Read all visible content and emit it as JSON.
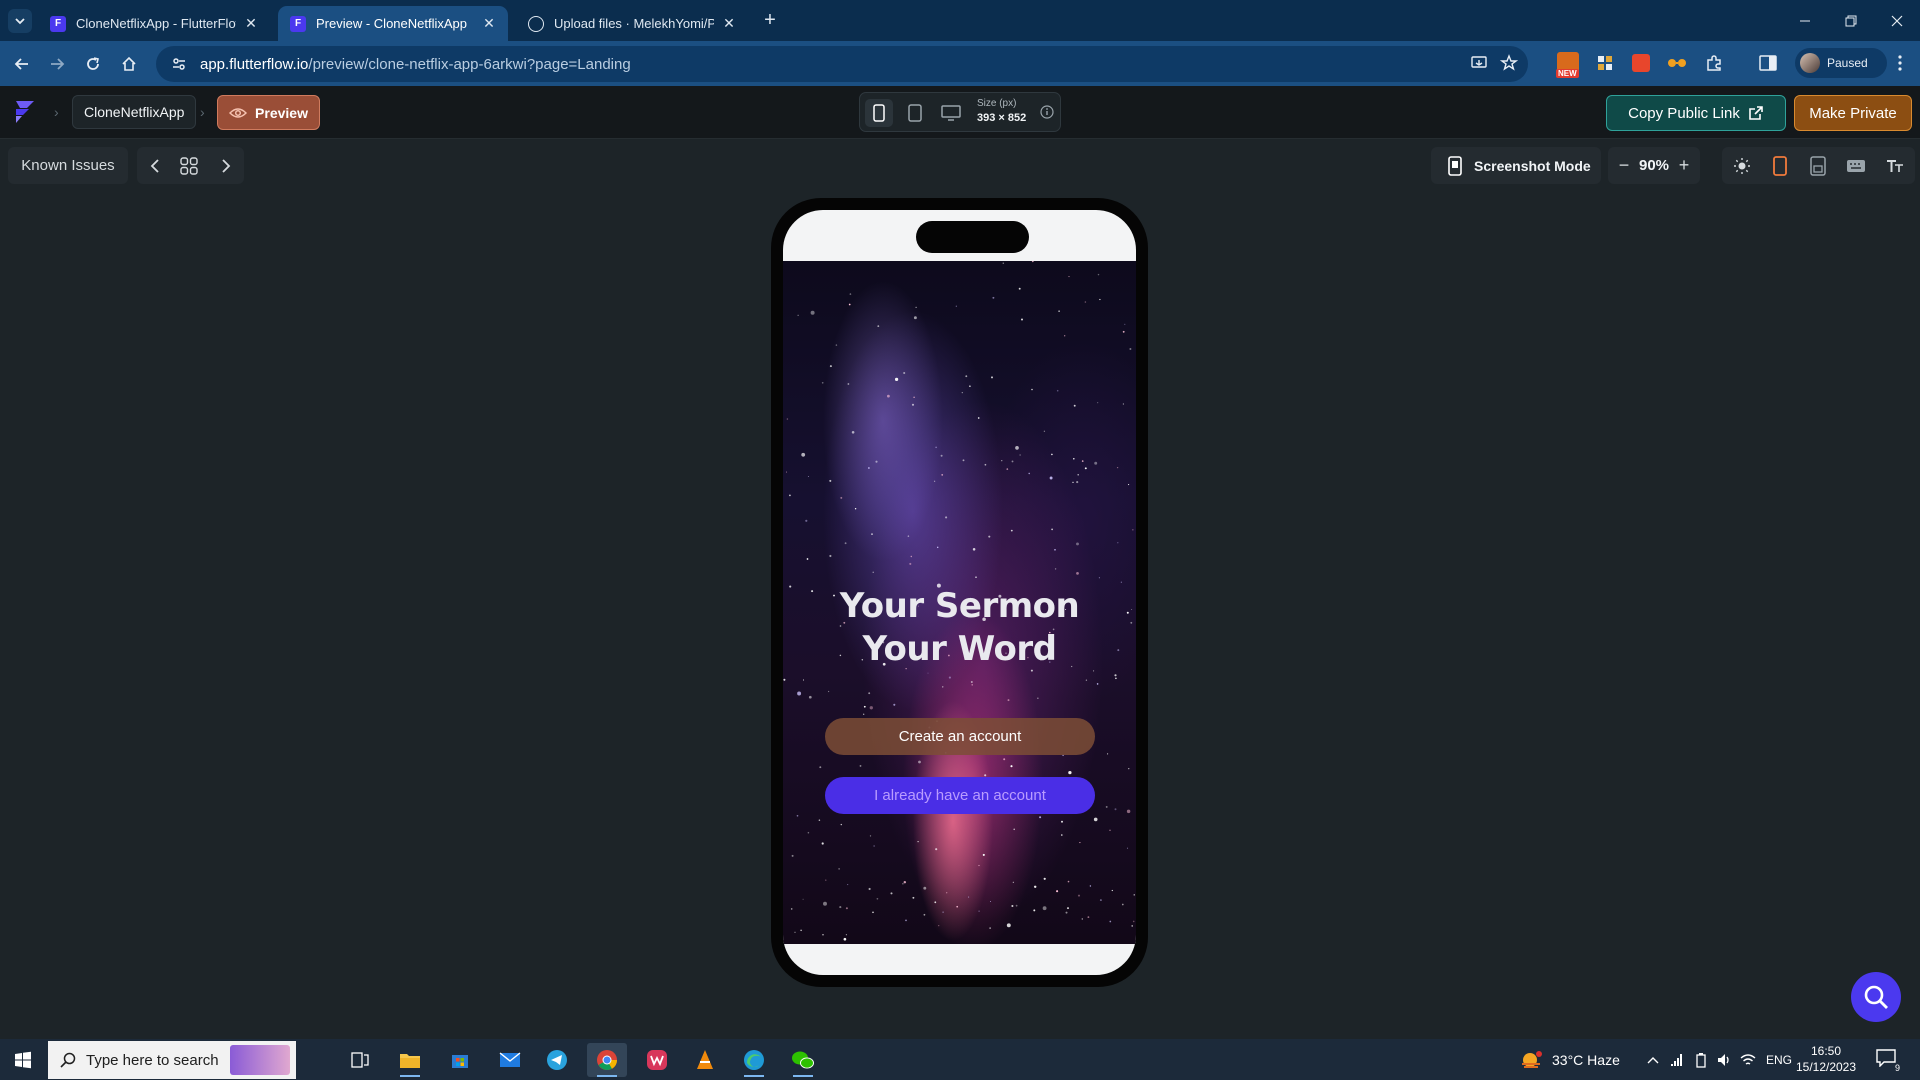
{
  "browser": {
    "tabs": [
      {
        "title": "CloneNetflixApp - FlutterFlow",
        "active": false,
        "icon": "flutterflow-icon"
      },
      {
        "title": "Preview - CloneNetflixApp",
        "active": true,
        "icon": "flutterflow-icon"
      },
      {
        "title": "Upload files · MelekhYomi/Proje",
        "active": false,
        "icon": "github-icon"
      }
    ],
    "close_glyph": "✕",
    "new_tab_glyph": "+",
    "url_host": "app.flutterflow.io",
    "url_path": "/preview/clone-netflix-app-6arkwi?page=Landing",
    "profile_label": "Paused",
    "extension_badge": "NEW"
  },
  "flutterflow": {
    "project_name": "CloneNetflixApp",
    "preview_label": "Preview",
    "size_label": "Size (px)",
    "size_value": "393 × 852",
    "copy_link_label": "Copy Public Link",
    "make_private_label": "Make Private",
    "known_issues_label": "Known Issues",
    "screenshot_mode_label": "Screenshot Mode",
    "zoom_value": "90%",
    "zoom_minus": "−",
    "zoom_plus": "+"
  },
  "app": {
    "page": "Landing",
    "headline_line1": "Your Sermon",
    "headline_line2": "Your Word",
    "create_account_label": "Create an account",
    "login_label": "I already have an account",
    "colors": {
      "login_button": "#4a2ee6",
      "login_text": "#b99cff",
      "create_button": "#7d4e36"
    }
  },
  "taskbar": {
    "search_placeholder": "Type here to search",
    "weather": "33°C  Haze",
    "language": "ENG",
    "time": "16:50",
    "date": "15/12/2023",
    "notification_count": "9"
  },
  "colors": {
    "chrome_tabstrip": "#0b2d4e",
    "chrome_toolbar": "#1b4f82",
    "flutterflow_bg": "#1d2428",
    "copy_link": "#0f4a48",
    "make_private": "#8c4e12",
    "preview_button": "#9a4e37",
    "search_fab": "#4b39ef"
  }
}
